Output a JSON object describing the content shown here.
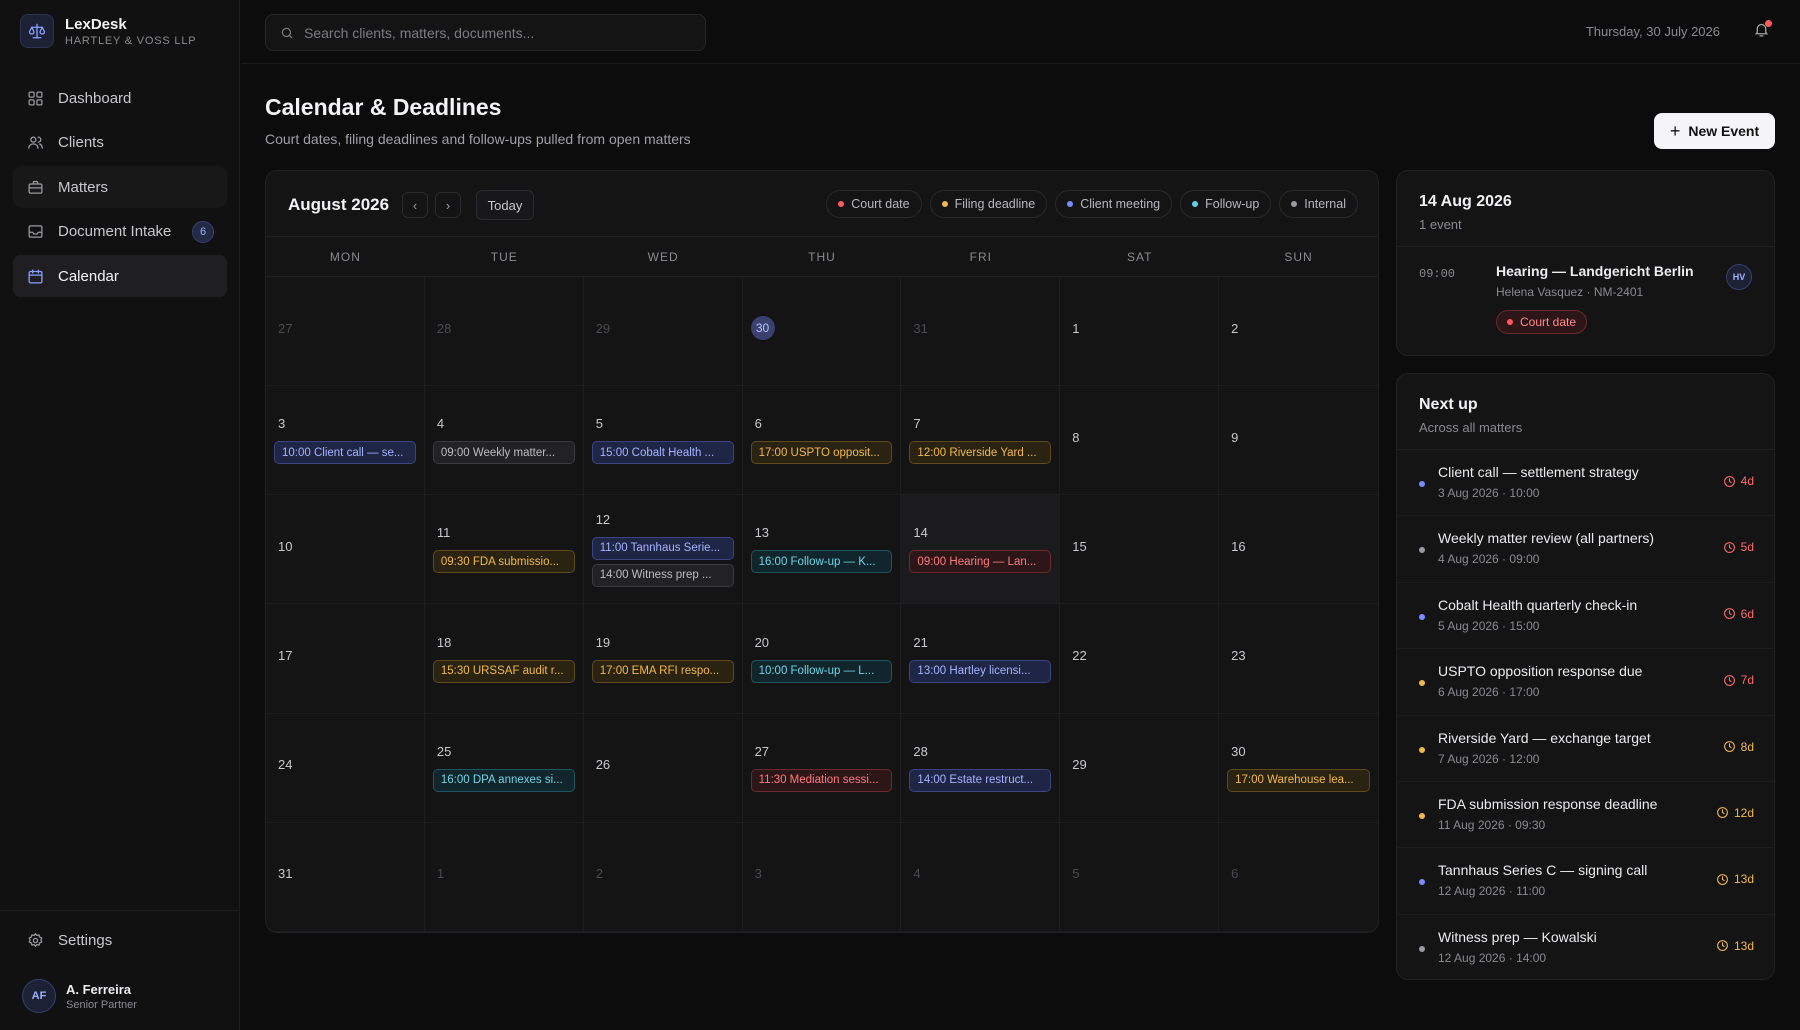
{
  "app": {
    "name": "LexDesk",
    "firm": "HARTLEY & VOSS LLP",
    "logo_icon": "scales-icon"
  },
  "nav": {
    "items": [
      {
        "label": "Dashboard",
        "icon": "grid-icon"
      },
      {
        "label": "Clients",
        "icon": "users-icon"
      },
      {
        "label": "Matters",
        "icon": "briefcase-icon"
      },
      {
        "label": "Document Intake",
        "icon": "inbox-icon",
        "badge": "6"
      },
      {
        "label": "Calendar",
        "icon": "calendar-icon"
      }
    ],
    "settings_label": "Settings"
  },
  "user": {
    "initials": "AF",
    "name": "A. Ferreira",
    "role": "Senior Partner"
  },
  "topbar": {
    "search_placeholder": "Search clients, matters, documents...",
    "date": "Thursday, 30 July 2026"
  },
  "header": {
    "title": "Calendar & Deadlines",
    "subtitle": "Court dates, filing deadlines and follow-ups pulled from open matters",
    "new_event_label": "New Event"
  },
  "calendar": {
    "month_label": "August 2026",
    "today_label": "Today",
    "legend": [
      {
        "label": "Court date",
        "color": "#ff5a5f"
      },
      {
        "label": "Filing deadline",
        "color": "#f0b94a"
      },
      {
        "label": "Client meeting",
        "color": "#7b8cff"
      },
      {
        "label": "Follow-up",
        "color": "#5fd0e6"
      },
      {
        "label": "Internal",
        "color": "#9a9aa0"
      }
    ],
    "weekdays": [
      "MON",
      "TUE",
      "WED",
      "THU",
      "FRI",
      "SAT",
      "SUN"
    ],
    "days": [
      {
        "num": "27",
        "other": true,
        "events": []
      },
      {
        "num": "28",
        "other": true,
        "events": []
      },
      {
        "num": "29",
        "other": true,
        "events": []
      },
      {
        "num": "30",
        "today": true,
        "events": []
      },
      {
        "num": "31",
        "other": true,
        "events": []
      },
      {
        "num": "1",
        "events": []
      },
      {
        "num": "2",
        "events": []
      },
      {
        "num": "3",
        "events": [
          {
            "text": "10:00 Client call — se...",
            "kind": "meeting"
          }
        ]
      },
      {
        "num": "4",
        "events": [
          {
            "text": "09:00 Weekly matter...",
            "kind": "internal"
          }
        ]
      },
      {
        "num": "5",
        "events": [
          {
            "text": "15:00 Cobalt Health ...",
            "kind": "meeting"
          }
        ]
      },
      {
        "num": "6",
        "events": [
          {
            "text": "17:00 USPTO opposit...",
            "kind": "filing"
          }
        ]
      },
      {
        "num": "7",
        "events": [
          {
            "text": "12:00 Riverside Yard ...",
            "kind": "filing"
          }
        ]
      },
      {
        "num": "8",
        "events": []
      },
      {
        "num": "9",
        "events": []
      },
      {
        "num": "10",
        "events": []
      },
      {
        "num": "11",
        "events": [
          {
            "text": "09:30 FDA submissio...",
            "kind": "filing"
          }
        ]
      },
      {
        "num": "12",
        "events": [
          {
            "text": "11:00 Tannhaus Serie...",
            "kind": "meeting"
          },
          {
            "text": "14:00 Witness prep ...",
            "kind": "internal"
          }
        ]
      },
      {
        "num": "13",
        "events": [
          {
            "text": "16:00 Follow-up — K...",
            "kind": "follow"
          }
        ]
      },
      {
        "num": "14",
        "selected": true,
        "events": [
          {
            "text": "09:00 Hearing — Lan...",
            "kind": "court"
          }
        ]
      },
      {
        "num": "15",
        "events": []
      },
      {
        "num": "16",
        "events": []
      },
      {
        "num": "17",
        "events": []
      },
      {
        "num": "18",
        "events": [
          {
            "text": "15:30 URSSAF audit r...",
            "kind": "filing"
          }
        ]
      },
      {
        "num": "19",
        "events": [
          {
            "text": "17:00 EMA RFI respo...",
            "kind": "filing"
          }
        ]
      },
      {
        "num": "20",
        "events": [
          {
            "text": "10:00 Follow-up — L...",
            "kind": "follow"
          }
        ]
      },
      {
        "num": "21",
        "events": [
          {
            "text": "13:00 Hartley licensi...",
            "kind": "meeting"
          }
        ]
      },
      {
        "num": "22",
        "events": []
      },
      {
        "num": "23",
        "events": []
      },
      {
        "num": "24",
        "events": []
      },
      {
        "num": "25",
        "events": [
          {
            "text": "16:00 DPA annexes si...",
            "kind": "follow"
          }
        ]
      },
      {
        "num": "26",
        "events": []
      },
      {
        "num": "27",
        "events": [
          {
            "text": "11:30 Mediation sessi...",
            "kind": "court"
          }
        ]
      },
      {
        "num": "28",
        "events": [
          {
            "text": "14:00 Estate restruct...",
            "kind": "meeting"
          }
        ]
      },
      {
        "num": "29",
        "events": []
      },
      {
        "num": "30",
        "events": [
          {
            "text": "17:00 Warehouse lea...",
            "kind": "filing"
          }
        ]
      },
      {
        "num": "31",
        "events": []
      },
      {
        "num": "1",
        "other": true,
        "events": []
      },
      {
        "num": "2",
        "other": true,
        "events": []
      },
      {
        "num": "3",
        "other": true,
        "events": []
      },
      {
        "num": "4",
        "other": true,
        "events": []
      },
      {
        "num": "5",
        "other": true,
        "events": []
      },
      {
        "num": "6",
        "other": true,
        "events": []
      }
    ]
  },
  "day_panel": {
    "date": "14 Aug 2026",
    "count": "1 event",
    "event": {
      "time": "09:00",
      "title": "Hearing — Landgericht Berlin",
      "meta": "Helena Vasquez · NM-2401",
      "tag": "Court date",
      "initials": "HV"
    }
  },
  "next_up": {
    "title": "Next up",
    "subtitle": "Across all matters",
    "items": [
      {
        "name": "Client call — settlement strategy",
        "when": "3 Aug 2026 · 10:00",
        "due": "4d",
        "dot": "#7b8cff",
        "due_tone": "red"
      },
      {
        "name": "Weekly matter review (all partners)",
        "when": "4 Aug 2026 · 09:00",
        "due": "5d",
        "dot": "#9a9aa0",
        "due_tone": "red"
      },
      {
        "name": "Cobalt Health quarterly check-in",
        "when": "5 Aug 2026 · 15:00",
        "due": "6d",
        "dot": "#7b8cff",
        "due_tone": "red"
      },
      {
        "name": "USPTO opposition response due",
        "when": "6 Aug 2026 · 17:00",
        "due": "7d",
        "dot": "#f0b94a",
        "due_tone": "red"
      },
      {
        "name": "Riverside Yard — exchange target",
        "when": "7 Aug 2026 · 12:00",
        "due": "8d",
        "dot": "#f0b94a",
        "due_tone": "amber"
      },
      {
        "name": "FDA submission response deadline",
        "when": "11 Aug 2026 · 09:30",
        "due": "12d",
        "dot": "#f0b94a",
        "due_tone": "amber"
      },
      {
        "name": "Tannhaus Series C — signing call",
        "when": "12 Aug 2026 · 11:00",
        "due": "13d",
        "dot": "#7b8cff",
        "due_tone": "amber"
      },
      {
        "name": "Witness prep — Kowalski",
        "when": "12 Aug 2026 · 14:00",
        "due": "13d",
        "dot": "#9a9aa0",
        "due_tone": "amber"
      }
    ]
  }
}
